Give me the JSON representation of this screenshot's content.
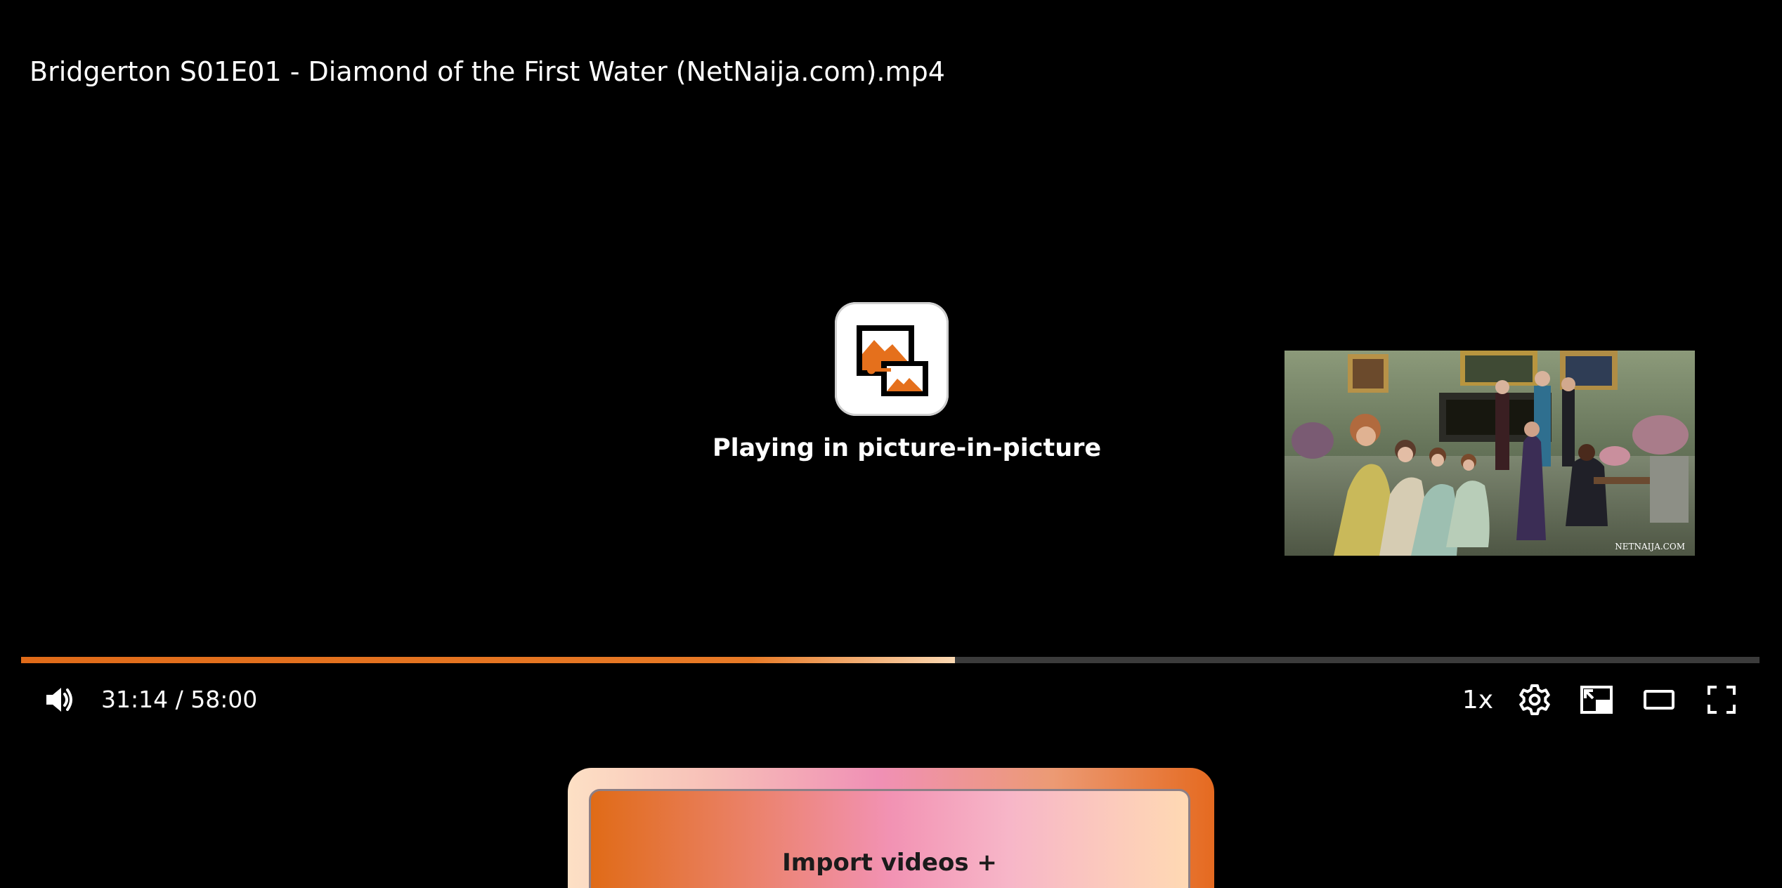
{
  "player": {
    "title": "Bridgerton S01E01 - Diamond of the First Water (NetNaija.com).mp4",
    "pip_message": "Playing in picture-in-picture",
    "pip_thumbnail_icon": "video-frame-thumbnail",
    "pip_icon": "picture-in-picture-icon",
    "progress": {
      "played_fraction": 0.537,
      "current": "31:14",
      "duration": "58:00"
    },
    "time_display": "31:14 / 58:00",
    "controls": {
      "volume_icon": "volume-icon",
      "speed_label": "1x",
      "settings_icon": "gear-icon",
      "pip_toggle_icon": "picture-in-picture-exit-icon",
      "theater_icon": "theater-mode-icon",
      "fullscreen_icon": "fullscreen-icon"
    },
    "accent_color": "#e5701c"
  },
  "import": {
    "label": "Import videos +"
  }
}
